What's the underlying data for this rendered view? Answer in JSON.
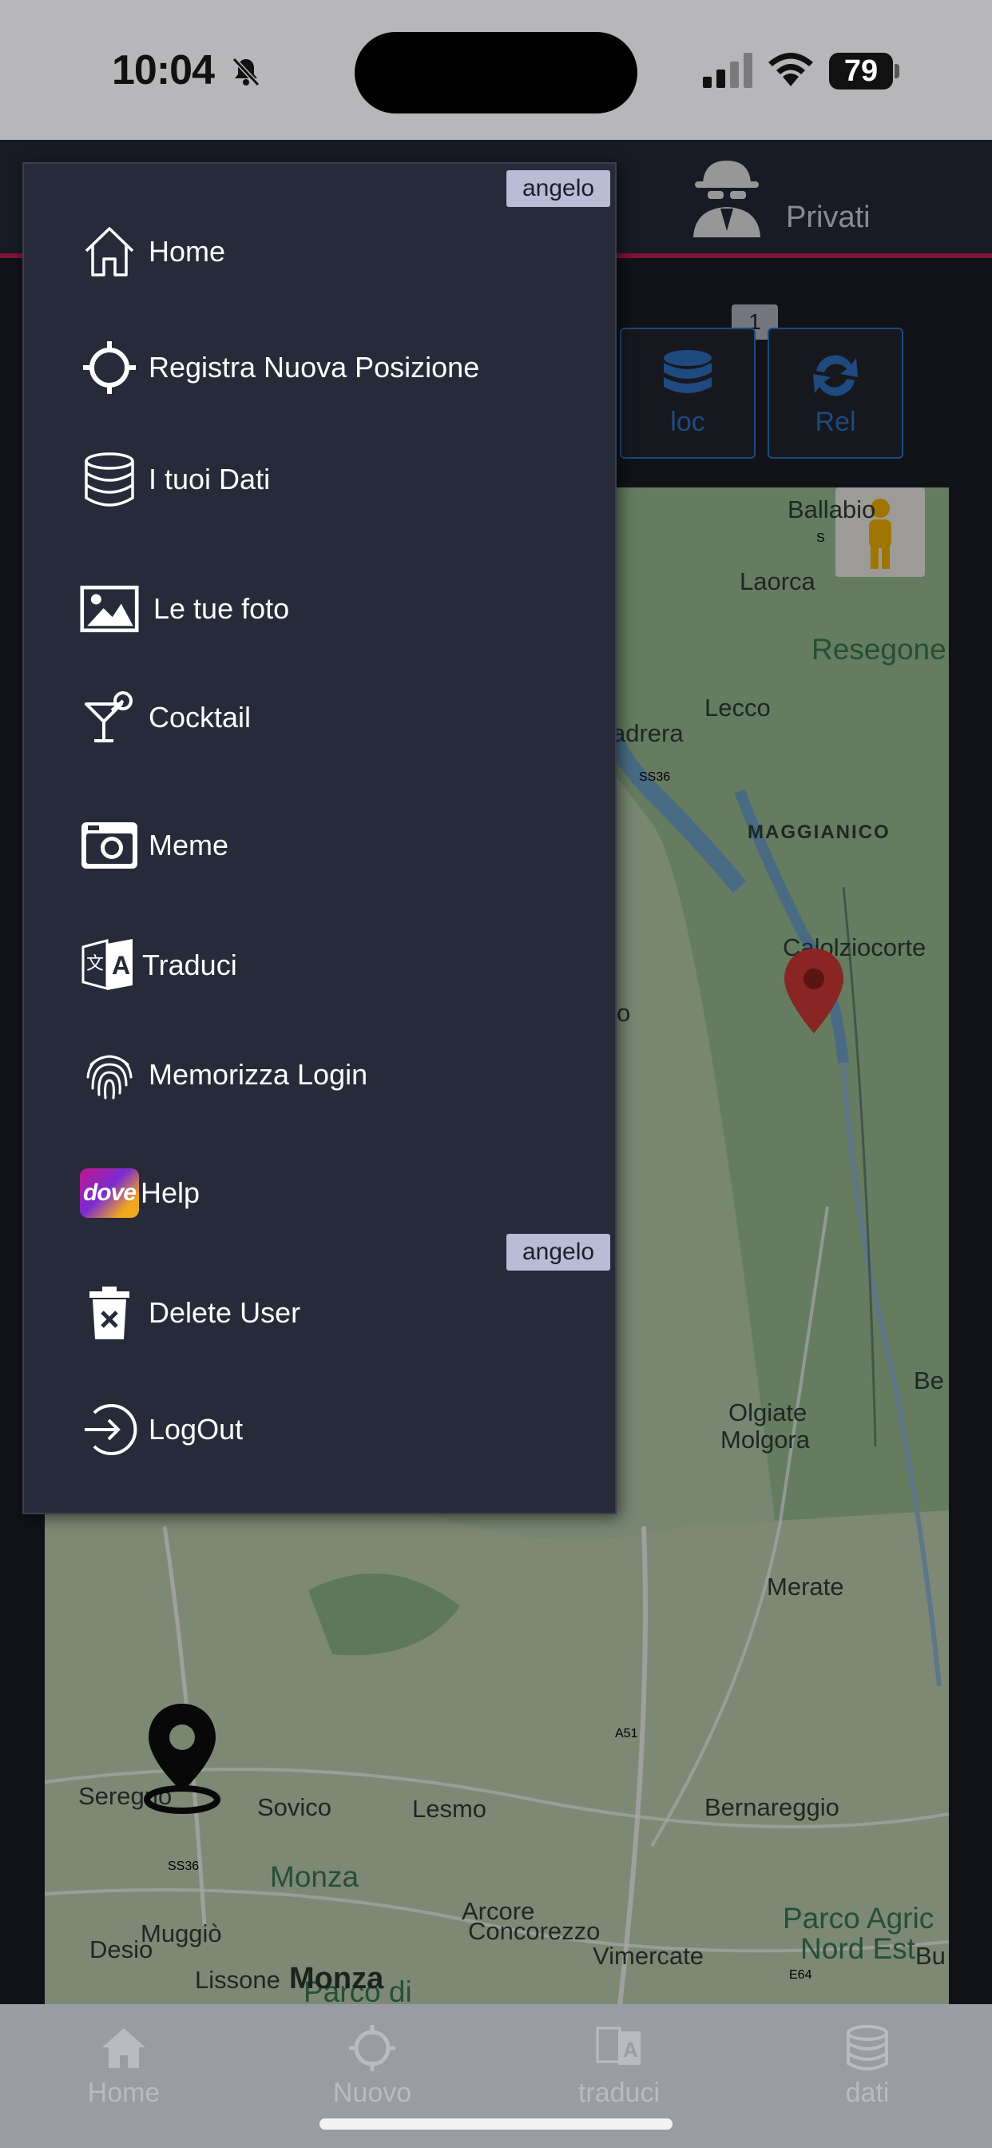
{
  "status_bar": {
    "time": "10:04",
    "battery": "79"
  },
  "header": {
    "private_label": "Privati"
  },
  "actions": {
    "badge": "1",
    "loc_label": "loc",
    "rel_label": "Rel"
  },
  "map": {
    "places": [
      "Ballabio",
      "Laorca",
      "Resegone",
      "Lecco",
      "adrera",
      "MAGGIANICO",
      "Calolziocorte",
      "o",
      "Be",
      "Olgiate",
      "Molgora",
      "Merate",
      "Seregno",
      "Sovico",
      "Lesmo",
      "Bernareggio",
      "Arcore",
      "Desio",
      "Lissone",
      "Vimercate",
      "Bu",
      "Parco di",
      "Monza",
      "Muggiò",
      "Monza",
      "Concorezzo",
      "Parco Agric",
      "Nord Est"
    ],
    "shields": [
      "SS36",
      "SS36",
      "A51",
      "E64",
      "S"
    ]
  },
  "menu": {
    "user_tag_top": "angelo",
    "user_tag_bottom": "angelo",
    "items": [
      {
        "label": "Home",
        "icon": "home-icon"
      },
      {
        "label": "Registra Nuova Posizione",
        "icon": "crosshair-icon"
      },
      {
        "label": "I tuoi Dati",
        "icon": "database-icon"
      },
      {
        "label": "Le tue foto",
        "icon": "image-icon"
      },
      {
        "label": "Cocktail",
        "icon": "cocktail-icon"
      },
      {
        "label": "Meme",
        "icon": "camera-icon"
      },
      {
        "label": "Traduci",
        "icon": "translate-icon"
      },
      {
        "label": "Memorizza Login",
        "icon": "fingerprint-icon"
      },
      {
        "label": "Help",
        "icon": "dove-logo"
      },
      {
        "label": "Delete User",
        "icon": "trash-icon"
      },
      {
        "label": "LogOut",
        "icon": "logout-icon"
      }
    ],
    "dove_logo_text": "dove"
  },
  "bottom_nav": {
    "home": "Home",
    "nuovo": "Nuovo",
    "traduci": "traduci",
    "dati": "dati"
  },
  "colors": {
    "menu_bg": "#272a38",
    "accent_red": "#c21e53",
    "accent_blue": "#2f72c4",
    "map_green": "#a9c6a2"
  }
}
